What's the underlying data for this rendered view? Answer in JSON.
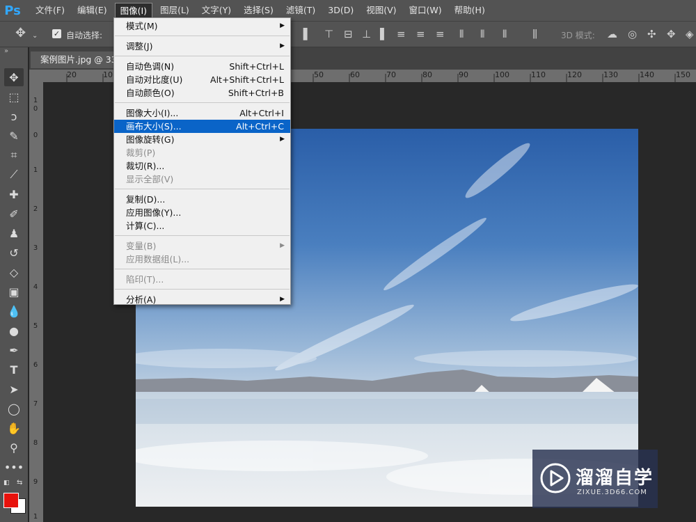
{
  "app": {
    "logo_text": "Ps"
  },
  "menubar": {
    "items": [
      "文件(F)",
      "编辑(E)",
      "图像(I)",
      "图层(L)",
      "文字(Y)",
      "选择(S)",
      "滤镜(T)",
      "3D(D)",
      "视图(V)",
      "窗口(W)",
      "帮助(H)"
    ],
    "active_index": 2
  },
  "options_bar": {
    "auto_select_label": "自动选择:",
    "mode_3d_label": "3D 模式:",
    "auto_select_checked": true
  },
  "document": {
    "tab_title": "案例图片.jpg @ 33"
  },
  "ruler": {
    "top_ticks": [
      "20",
      "10",
      "50",
      "60",
      "70",
      "80",
      "90",
      "100",
      "110",
      "120",
      "130",
      "140",
      "150"
    ],
    "left_ticks": [
      "1",
      "0",
      "0",
      "1",
      "2",
      "3",
      "4",
      "5",
      "6",
      "7",
      "8",
      "9",
      "1"
    ]
  },
  "image_menu": {
    "items": [
      {
        "label": "模式(M)",
        "shortcut": "",
        "submenu": true,
        "disabled": false
      },
      {
        "separator": true
      },
      {
        "label": "调整(J)",
        "shortcut": "",
        "submenu": true,
        "disabled": false
      },
      {
        "separator": true
      },
      {
        "label": "自动色调(N)",
        "shortcut": "Shift+Ctrl+L",
        "submenu": false,
        "disabled": false
      },
      {
        "label": "自动对比度(U)",
        "shortcut": "Alt+Shift+Ctrl+L",
        "submenu": false,
        "disabled": false
      },
      {
        "label": "自动颜色(O)",
        "shortcut": "Shift+Ctrl+B",
        "submenu": false,
        "disabled": false
      },
      {
        "separator": true
      },
      {
        "label": "图像大小(I)...",
        "shortcut": "Alt+Ctrl+I",
        "submenu": false,
        "disabled": false
      },
      {
        "label": "画布大小(S)...",
        "shortcut": "Alt+Ctrl+C",
        "submenu": false,
        "disabled": false,
        "selected": true
      },
      {
        "label": "图像旋转(G)",
        "shortcut": "",
        "submenu": true,
        "disabled": false
      },
      {
        "label": "裁剪(P)",
        "shortcut": "",
        "submenu": false,
        "disabled": true
      },
      {
        "label": "裁切(R)...",
        "shortcut": "",
        "submenu": false,
        "disabled": false
      },
      {
        "label": "显示全部(V)",
        "shortcut": "",
        "submenu": false,
        "disabled": true
      },
      {
        "separator": true
      },
      {
        "label": "复制(D)...",
        "shortcut": "",
        "submenu": false,
        "disabled": false
      },
      {
        "label": "应用图像(Y)...",
        "shortcut": "",
        "submenu": false,
        "disabled": false
      },
      {
        "label": "计算(C)...",
        "shortcut": "",
        "submenu": false,
        "disabled": false
      },
      {
        "separator": true
      },
      {
        "label": "变量(B)",
        "shortcut": "",
        "submenu": true,
        "disabled": true
      },
      {
        "label": "应用数据组(L)...",
        "shortcut": "",
        "submenu": false,
        "disabled": true
      },
      {
        "separator": true
      },
      {
        "label": "陷印(T)...",
        "shortcut": "",
        "submenu": false,
        "disabled": true
      },
      {
        "separator": true
      },
      {
        "label": "分析(A)",
        "shortcut": "",
        "submenu": true,
        "disabled": false
      }
    ]
  },
  "colors": {
    "foreground": "#e8120c",
    "background": "#ffffff",
    "menu_highlight": "#0a64c8"
  },
  "watermark": {
    "title": "溜溜自学",
    "url": "ZIXUE.3D66.COM"
  }
}
